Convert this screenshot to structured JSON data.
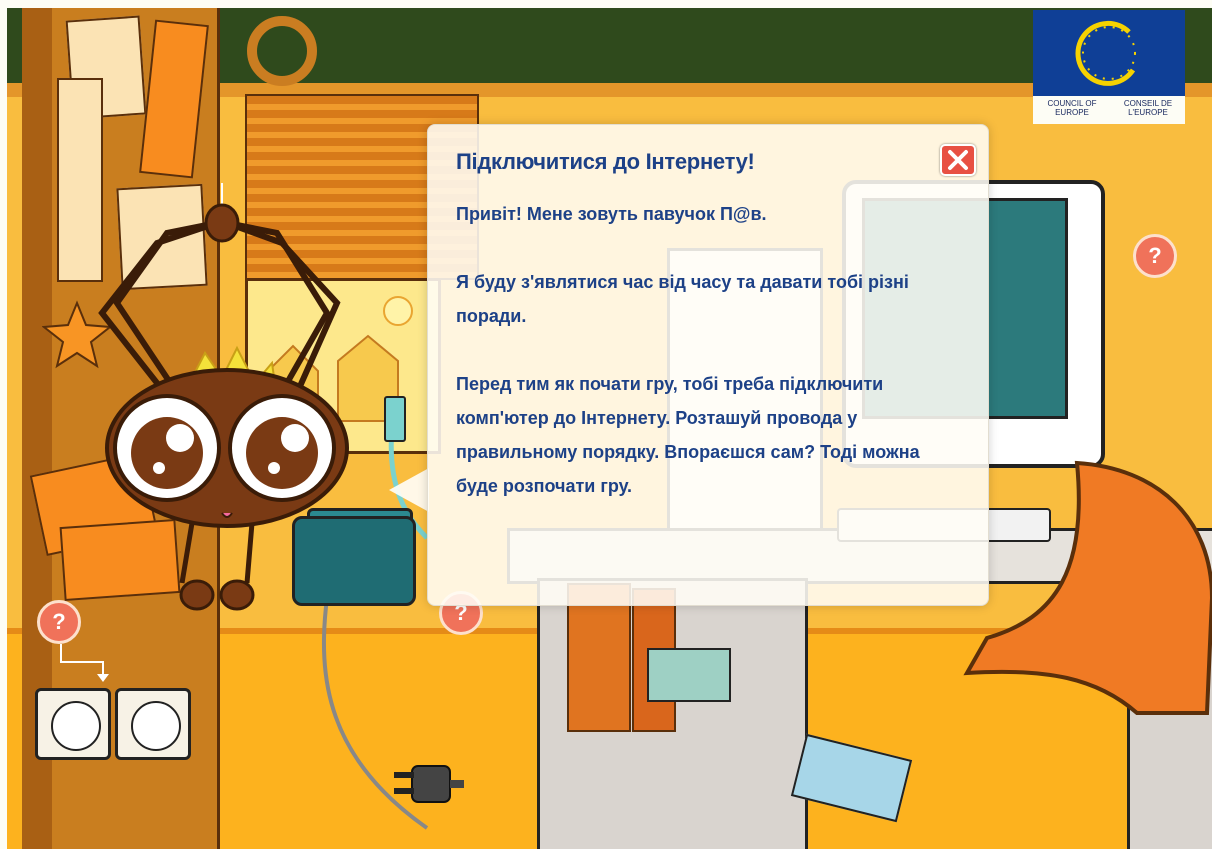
{
  "dialog": {
    "title": "Підключитися до Інтернету!",
    "paragraphs": [
      "Привіт! Мене зовуть павучок П@в.",
      "Я буду з'являтися час від часу та давати тобі різні поради.",
      "Перед тим як почати гру, тобі треба підключити комп'ютер до Інтернету. Розташуй провода у правильному порядку. Впораєшся сам? Тоді можна буде розпочати гру."
    ],
    "close_icon": "close-x-icon"
  },
  "logo": {
    "left_caption": "COUNCIL OF EUROPE",
    "right_caption": "CONSEIL DE L'EUROPE"
  },
  "help_hotspots": {
    "label": "?"
  },
  "colors": {
    "dialog_text": "#1d4187",
    "close_button": "#e85043",
    "help_bubble": "#f0725a",
    "wall": "#f9bd3f",
    "router": "#1f6c73"
  }
}
